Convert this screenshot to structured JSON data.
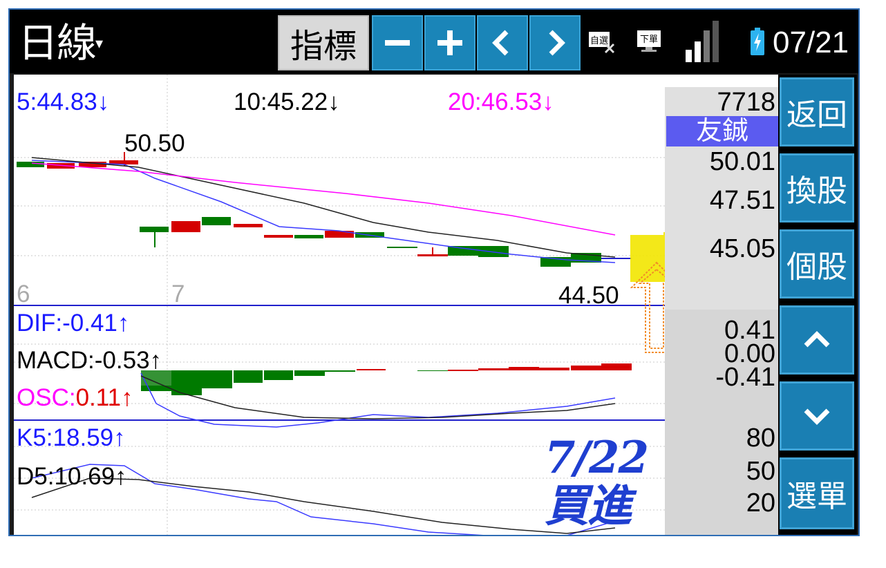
{
  "topbar": {
    "title": "日線",
    "indicator_label": "指標",
    "minus_label": "−",
    "plus_label": "+",
    "prev_label": "<",
    "next_label": ">",
    "watchlist_icon_text": "自選",
    "order_icon_text": "下單",
    "date": "07/21"
  },
  "price_panel": {
    "ma5": "5:44.83↓",
    "ma10": "10:45.22↓",
    "ma20": "20:46.53↓",
    "high_label": "50.50",
    "low_label": "44.50",
    "month_6": "6",
    "month_7": "7",
    "colors": {
      "ma5": "#1a1aff",
      "ma10": "#000000",
      "ma20": "#ff00ff",
      "up": "#d40000",
      "down": "#007a00"
    }
  },
  "macd_panel": {
    "dif": "DIF:-0.41↑",
    "macd": "MACD:-0.53↑",
    "osc_prefix": "OSC:",
    "osc_value": "0.11↑"
  },
  "kd_panel": {
    "k": "K5:18.59↑",
    "d": "D5:10.69↑"
  },
  "right_column": {
    "stock_code": "7718",
    "stock_name": "友鋮",
    "price_ticks": [
      "50.01",
      "47.51",
      "45.05"
    ],
    "macd_ticks": [
      "0.41",
      "0.00",
      "-0.41"
    ],
    "kd_ticks": [
      "80",
      "50",
      "20"
    ]
  },
  "side_buttons": {
    "back": "返回",
    "switch": "換股",
    "individual": "個股",
    "order_list": "選單"
  },
  "annotation": {
    "handwriting": "7/22買進",
    "arrow_color": "#f28c28",
    "highlight_color": "#f2e600"
  }
}
